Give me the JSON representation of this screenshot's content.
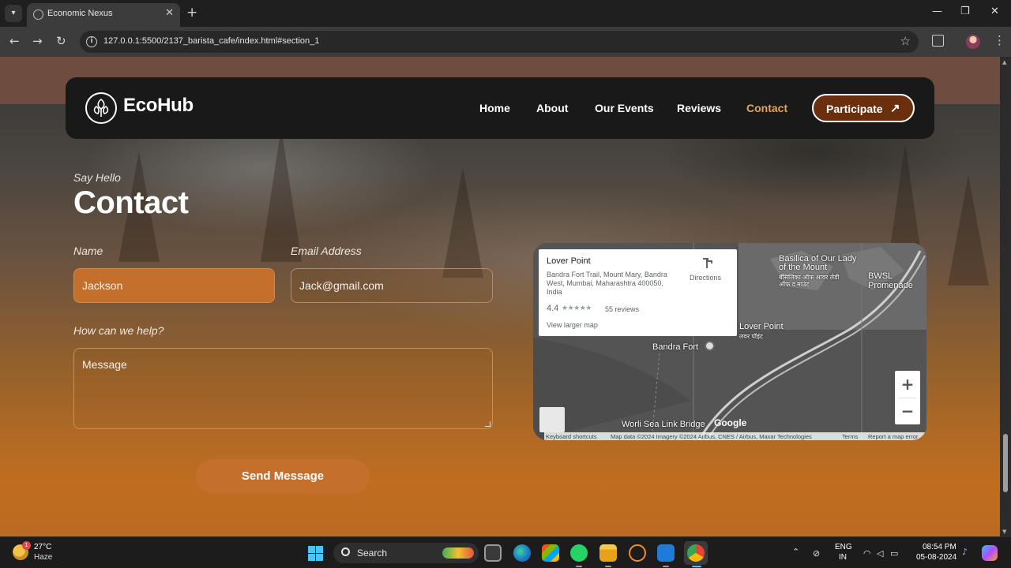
{
  "browser": {
    "tab_title": "Economic Nexus",
    "url": "127.0.0.1:5500/2137_barista_cafe/index.html#section_1"
  },
  "navbar": {
    "brand": "EcoHub",
    "links": [
      "Home",
      "About",
      "Our Events",
      "Reviews",
      "Contact"
    ],
    "active_link": "Contact",
    "cta_label": "Participate",
    "cta_icon": "arrow-up-right-icon"
  },
  "contact": {
    "eyebrow": "Say Hello",
    "title": "Contact",
    "name_label": "Name",
    "name_value": "Jackson",
    "email_label": "Email Address",
    "email_value": "Jack@gmail.com",
    "help_label": "How can we help?",
    "message_placeholder": "Message",
    "submit_label": "Send Message"
  },
  "map": {
    "place_name": "Lover Point",
    "address": "Bandra Fort Trail, Mount Mary, Bandra West, Mumbai, Maharashtra 400050, India",
    "rating": "4.4",
    "stars": "★★★★★",
    "reviews": "55 reviews",
    "larger_map": "View larger map",
    "directions": "Directions",
    "labels": {
      "basilica": "Basilica of Our Lady of the Mount",
      "basilica_local": "बॅसिलिका ऑफ आवर लेडी ऑफ द माउंट",
      "bwsl": "BWSL Promenade",
      "lover_point": "Lover Point",
      "lover_point_local": "लवर पॉइंट",
      "bandra_fort": "Bandra Fort",
      "sea_link": "Worli Sea Link Bridge"
    },
    "google": "Google",
    "attribution": [
      "Keyboard shortcuts",
      "Map data ©2024 Imagery ©2024 Airbus, CNES / Airbus, Maxar Technologies",
      "Terms",
      "Report a map error"
    ]
  },
  "taskbar": {
    "temperature": "27°C",
    "weather": "Haze",
    "weather_badge": "1",
    "search_label": "Search",
    "language": "ENG",
    "region": "IN",
    "time": "08:54 PM",
    "date": "05-08-2024"
  },
  "colors": {
    "accent": "#c46f2b",
    "nav_active": "#e6a35a",
    "cta_fill": "#6b2f0d",
    "navbar_bg": "#191919"
  }
}
